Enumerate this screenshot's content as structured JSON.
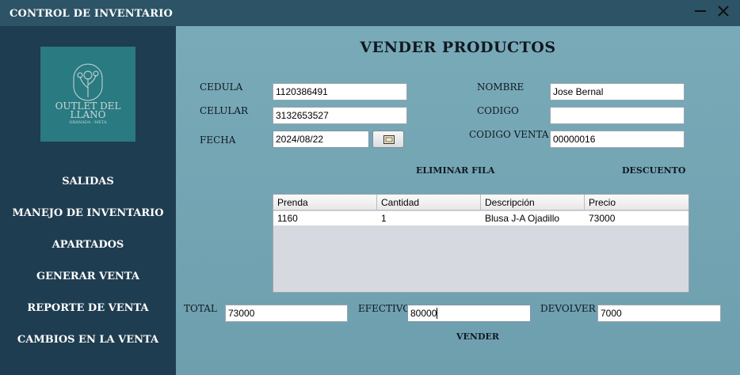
{
  "window": {
    "title": "CONTROL DE INVENTARIO"
  },
  "sidebar": {
    "logo": {
      "text_line1": "OUTLET DEL",
      "text_line2": "LLANO",
      "text_line3": "GRANADA - META"
    },
    "items": [
      {
        "label": "SALIDAS"
      },
      {
        "label": "MANEJO DE INVENTARIO"
      },
      {
        "label": "APARTADOS"
      },
      {
        "label": "GENERAR VENTA"
      },
      {
        "label": "REPORTE DE VENTA"
      },
      {
        "label": "CAMBIOS EN LA  VENTA"
      }
    ]
  },
  "main": {
    "title": "VENDER PRODUCTOS",
    "form": {
      "cedula_label": "CEDULA",
      "cedula_value": "1120386491",
      "celular_label": "CELULAR",
      "celular_value": "3132653527",
      "fecha_label": "FECHA",
      "fecha_value": "2024/08/22",
      "nombre_label": "NOMBRE",
      "nombre_value": "Jose Bernal",
      "codigo_label": "CODIGO",
      "codigo_value": "",
      "codigo_venta_label": "CODIGO  VENTA",
      "codigo_venta_value": "00000016"
    },
    "actions": {
      "eliminar_fila": "ELIMINAR FILA",
      "descuento": "DESCUENTO",
      "vender": "VENDER"
    },
    "table": {
      "columns": [
        "Prenda",
        "Cantidad",
        "Descripción",
        "Precio"
      ],
      "rows": [
        [
          "1160",
          "1",
          "Blusa J-A Ojadillo",
          "73000"
        ]
      ]
    },
    "totals": {
      "total_label": "TOTAL",
      "total_value": "73000",
      "efectivo_label": "EFECTIVO",
      "efectivo_value": "80000",
      "devolver_label": "DEVOLVER",
      "devolver_value": "7000"
    }
  },
  "colors": {
    "sidebar_bg": "#1f3d50",
    "titlebar_bg": "#2c5366",
    "main_bg": "#79aab8",
    "logo_bg": "#2a7a82"
  }
}
